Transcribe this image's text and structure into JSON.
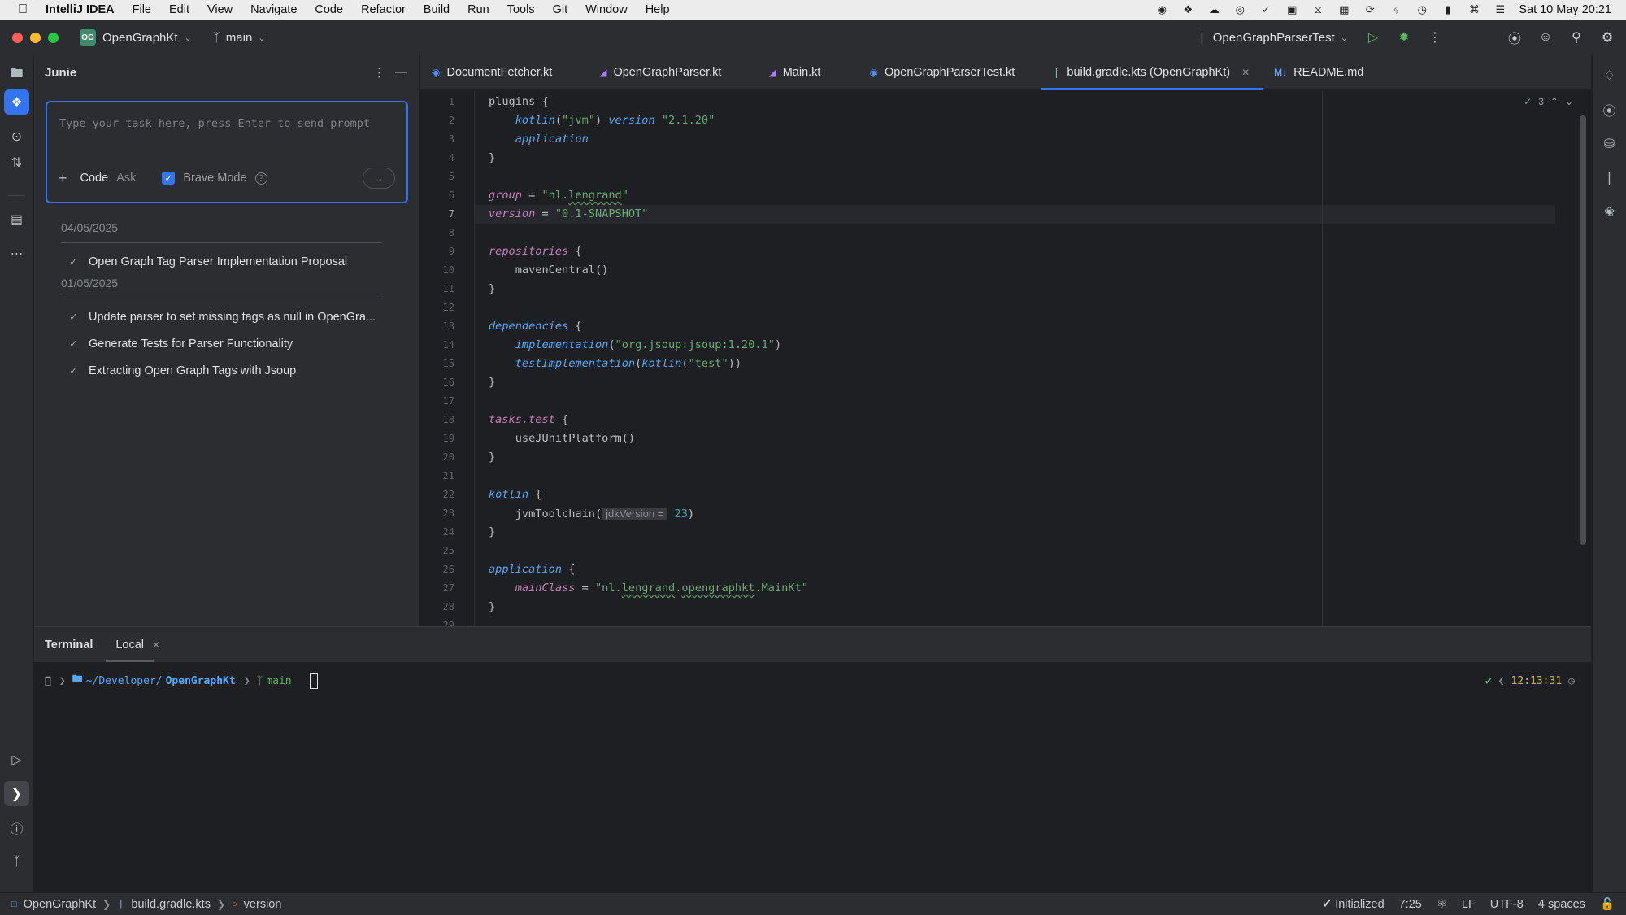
{
  "menubar": {
    "app_name": "IntelliJ IDEA",
    "items": [
      "File",
      "Edit",
      "View",
      "Navigate",
      "Code",
      "Refactor",
      "Build",
      "Run",
      "Tools",
      "Git",
      "Window",
      "Help"
    ],
    "clock": "Sat 10 May  20:21"
  },
  "toolbar": {
    "project_badge": "OG",
    "project_name": "OpenGraphKt",
    "branch": "main",
    "run_config": "OpenGraphParserTest"
  },
  "junie": {
    "title": "Junie",
    "prompt_placeholder": "Type your task here, press Enter to send prompt",
    "mode_code": "Code",
    "mode_ask": "Ask",
    "brave_mode": "Brave Mode",
    "help": "?",
    "history": [
      {
        "date": "04/05/2025",
        "items": [
          "Open Graph Tag Parser Implementation Proposal"
        ]
      },
      {
        "date": "01/05/2025",
        "items": [
          "Update parser to set missing tags as null in OpenGra...",
          "Generate Tests for Parser Functionality",
          "Extracting Open Graph Tags with Jsoup"
        ]
      }
    ]
  },
  "tabs": [
    {
      "label": "DocumentFetcher.kt",
      "icon": "kotlin-file-icon"
    },
    {
      "label": "OpenGraphParser.kt",
      "icon": "kotlin-class-icon"
    },
    {
      "label": "Main.kt",
      "icon": "kotlin-class-icon"
    },
    {
      "label": "OpenGraphParserTest.kt",
      "icon": "test-class-icon"
    },
    {
      "label": "build.gradle.kts (OpenGraphKt)",
      "icon": "gradle-icon",
      "active": true
    },
    {
      "label": "README.md",
      "icon": "markdown-icon"
    }
  ],
  "editor": {
    "inspections_count": "3",
    "current_line": 7,
    "line_count": 29,
    "lines": [
      [
        [
          "p",
          "plugins {"
        ]
      ],
      [
        [
          "p",
          "    "
        ],
        [
          "e",
          "kotlin"
        ],
        [
          "p",
          "("
        ],
        [
          "s",
          "\"jvm\""
        ],
        [
          "p",
          ") "
        ],
        [
          "e",
          "version"
        ],
        [
          "p",
          " "
        ],
        [
          "s",
          "\"2.1.20\""
        ]
      ],
      [
        [
          "p",
          "    "
        ],
        [
          "e",
          "application"
        ]
      ],
      [
        [
          "p",
          "}"
        ]
      ],
      [],
      [
        [
          "v",
          "group"
        ],
        [
          "p",
          " = "
        ],
        [
          "s",
          "\"nl."
        ],
        [
          "sq",
          "lengrand"
        ],
        [
          "s",
          "\""
        ]
      ],
      [
        [
          "v",
          "version"
        ],
        [
          "p",
          " = "
        ],
        [
          "s",
          "\"0.1-SNAPSHOT\""
        ]
      ],
      [],
      [
        [
          "v",
          "repositories"
        ],
        [
          "p",
          " {"
        ]
      ],
      [
        [
          "p",
          "    mavenCentral()"
        ]
      ],
      [
        [
          "p",
          "}"
        ]
      ],
      [],
      [
        [
          "e",
          "dependencies"
        ],
        [
          "p",
          " {"
        ]
      ],
      [
        [
          "p",
          "    "
        ],
        [
          "e",
          "implementation"
        ],
        [
          "p",
          "("
        ],
        [
          "s",
          "\"org.jsoup:jsoup:1.20.1\""
        ],
        [
          "p",
          ")"
        ]
      ],
      [
        [
          "p",
          "    "
        ],
        [
          "e",
          "testImplementation"
        ],
        [
          "p",
          "("
        ],
        [
          "e",
          "kotlin"
        ],
        [
          "p",
          "("
        ],
        [
          "s",
          "\"test\""
        ],
        [
          "p",
          "))"
        ]
      ],
      [
        [
          "p",
          "}"
        ]
      ],
      [],
      [
        [
          "v",
          "tasks.test"
        ],
        [
          "p",
          " {"
        ]
      ],
      [
        [
          "p",
          "    useJUnitPlatform()"
        ]
      ],
      [
        [
          "p",
          "}"
        ]
      ],
      [],
      [
        [
          "e",
          "kotlin"
        ],
        [
          "p",
          " {"
        ]
      ],
      [
        [
          "p",
          "    jvmToolchain("
        ],
        [
          "h",
          "jdkVersion ="
        ],
        [
          "n",
          " 23"
        ],
        [
          "p",
          ")"
        ]
      ],
      [
        [
          "p",
          "}"
        ]
      ],
      [],
      [
        [
          "e",
          "application"
        ],
        [
          "p",
          " {"
        ]
      ],
      [
        [
          "p",
          "    "
        ],
        [
          "v",
          "mainClass"
        ],
        [
          "p",
          " = "
        ],
        [
          "s",
          "\"nl."
        ],
        [
          "sq",
          "lengrand"
        ],
        [
          "s",
          "."
        ],
        [
          "sq",
          "opengraphkt"
        ],
        [
          "s",
          ".MainKt\""
        ]
      ],
      [
        [
          "p",
          "}"
        ]
      ],
      []
    ]
  },
  "terminal": {
    "title": "Terminal",
    "tab": "Local",
    "path_prefix": "~/Developer/",
    "path_dir": "OpenGraphKt",
    "branch": "main",
    "check": "✔",
    "time": "12:13:31"
  },
  "statusbar": {
    "project": "OpenGraphKt",
    "file": "build.gradle.kts",
    "symbol": "version",
    "status": "Initialized",
    "position": "7:25",
    "line_ending": "LF",
    "encoding": "UTF-8",
    "indent": "4 spaces"
  },
  "colors": {
    "accent": "#3574f0",
    "background": "#1e1f22",
    "panel": "#2b2d30",
    "string": "#6aab73",
    "keyword_ext": "#56a8f5",
    "property": "#c77dbb",
    "number": "#2aacb8"
  }
}
